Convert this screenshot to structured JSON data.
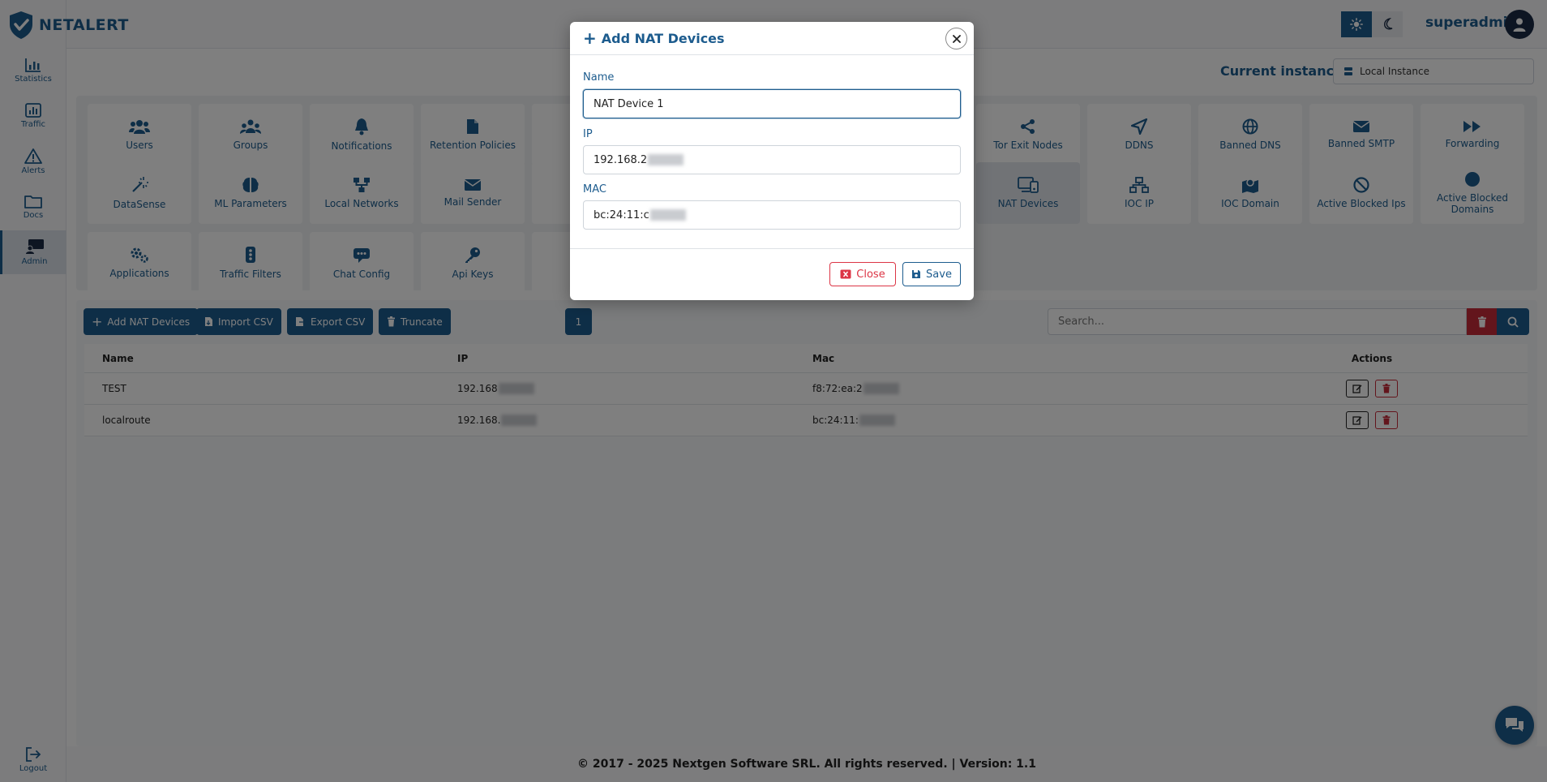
{
  "app": {
    "logo_text": "NETALERT"
  },
  "colors": {
    "accent": "#1d5c8e",
    "danger": "#c72a39",
    "dark": "#1a2b45"
  },
  "sidebar": {
    "items": [
      {
        "label": "Statistics",
        "icon": "bar-chart-icon"
      },
      {
        "label": "Traffic",
        "icon": "traffic-chart-icon"
      },
      {
        "label": "Alerts",
        "icon": "warning-icon"
      },
      {
        "label": "Docs",
        "icon": "folder-icon"
      },
      {
        "label": "Admin",
        "icon": "admin-monitor-icon"
      }
    ],
    "logout_label": "Logout"
  },
  "header": {
    "user": "superadmin",
    "instance_label": "Current instance:",
    "instance_value": "Local Instance"
  },
  "tiles": [
    "Users",
    "Groups",
    "Notifications",
    "Retention Policies",
    "Tor Exit Nodes",
    "DDNS",
    "Banned DNS",
    "Banned SMTP",
    "Forwarding",
    "DataSense",
    "ML Parameters",
    "Local Networks",
    "Mail Sender",
    "NAT Devices",
    "IOC IP",
    "IOC Domain",
    "Active Blocked Ips",
    "Active Blocked Domains",
    "Applications",
    "Traffic Filters",
    "Chat Config",
    "Api Keys"
  ],
  "toolbar": {
    "add_label": "Add NAT Devices",
    "import_label": "Import CSV",
    "export_label": "Export CSV",
    "truncate_label": "Truncate",
    "page": "1",
    "search_placeholder": "Search..."
  },
  "table": {
    "headers": {
      "name": "Name",
      "ip": "IP",
      "mac": "Mac",
      "actions": "Actions"
    },
    "rows": [
      {
        "name": "TEST",
        "ip": "192.168",
        "mac": "f8:72:ea:2"
      },
      {
        "name": "localroute",
        "ip": "192.168.",
        "mac": "bc:24:11:"
      }
    ]
  },
  "modal": {
    "title": "Add NAT Devices",
    "name_label": "Name",
    "name_value": "NAT Device 1",
    "ip_label": "IP",
    "ip_value": "192.168.2",
    "mac_label": "MAC",
    "mac_value": "bc:24:11:c",
    "close_label": "Close",
    "save_label": "Save"
  },
  "footer": {
    "text": "© 2017 - 2025 Nextgen Software SRL. All rights reserved. | Version: 1.1"
  }
}
